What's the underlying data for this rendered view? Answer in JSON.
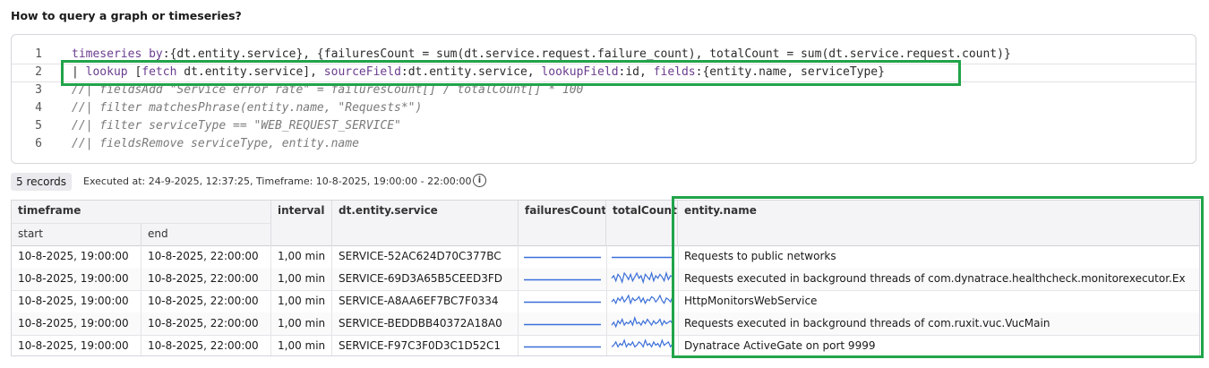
{
  "page": {
    "title": "How to query a graph or timeseries?"
  },
  "editor": {
    "lines": [
      {
        "num": "1",
        "parts": [
          {
            "t": "timeseries by",
            "c": "kw"
          },
          {
            "t": ":{dt.entity.service}, {failuresCount = sum(dt.service.request.failure_count), totalCount = sum(dt.service.request.count)}",
            "c": ""
          }
        ]
      },
      {
        "num": "2",
        "parts": [
          {
            "t": "| ",
            "c": ""
          },
          {
            "t": "lookup",
            "c": "kw"
          },
          {
            "t": " [",
            "c": ""
          },
          {
            "t": "fetch",
            "c": "kw"
          },
          {
            "t": " dt.entity.service], ",
            "c": ""
          },
          {
            "t": "sourceField",
            "c": "kw"
          },
          {
            "t": ":dt.entity.service, ",
            "c": ""
          },
          {
            "t": "lookupField",
            "c": "kw"
          },
          {
            "t": ":id, ",
            "c": ""
          },
          {
            "t": "fields",
            "c": "kw"
          },
          {
            "t": ":{entity.name, serviceType}",
            "c": ""
          }
        ]
      },
      {
        "num": "3",
        "parts": [
          {
            "t": "//| fieldsAdd \"Service error rate\" = failuresCount[] / totalCount[] * 100",
            "c": "comment"
          }
        ]
      },
      {
        "num": "4",
        "parts": [
          {
            "t": "//| filter matchesPhrase(entity.name, \"Requests*\")",
            "c": "comment"
          }
        ]
      },
      {
        "num": "5",
        "parts": [
          {
            "t": "//| filter serviceType == \"WEB_REQUEST_SERVICE\"",
            "c": "comment"
          }
        ]
      },
      {
        "num": "6",
        "parts": [
          {
            "t": "//| fieldsRemove serviceType, entity.name",
            "c": "comment"
          }
        ]
      }
    ]
  },
  "results": {
    "records_label": "5 records",
    "executed_text": "Executed at: 24-9-2025, 12:37:25, Timeframe: 10-8-2025, 19:00:00 - 22:00:00",
    "info_glyph": "i"
  },
  "table": {
    "group_header": "timeframe",
    "headers": {
      "start": "start",
      "end": "end",
      "interval": "interval",
      "service": "dt.entity.service",
      "failures": "failuresCount",
      "total": "totalCount",
      "entity_name": "entity.name"
    },
    "rows": [
      {
        "start": "10-8-2025, 19:00:00",
        "end": "10-8-2025, 22:00:00",
        "interval": "1,00 min",
        "service": "SERVICE-52AC624D70C377BC",
        "failures": [
          0,
          0,
          0,
          0,
          0,
          0,
          0,
          0,
          0,
          0,
          0,
          0,
          0,
          0,
          0,
          0,
          0,
          0,
          0,
          0,
          0,
          0,
          0,
          0,
          0,
          0,
          0,
          0,
          0,
          0
        ],
        "total": [
          0,
          0,
          0,
          0,
          0,
          0,
          0,
          0,
          0,
          0,
          0,
          0,
          0,
          0,
          0,
          0,
          0,
          0,
          0,
          0,
          0,
          0,
          0,
          0,
          0,
          0,
          0,
          0,
          0,
          0
        ],
        "entity_name": "Requests to public networks"
      },
      {
        "start": "10-8-2025, 19:00:00",
        "end": "10-8-2025, 22:00:00",
        "interval": "1,00 min",
        "service": "SERVICE-69D3A65B5CEED3FD",
        "failures": [
          0,
          0,
          0,
          0,
          0,
          0,
          0,
          0,
          0,
          0,
          0,
          0,
          0,
          0,
          0,
          0,
          0,
          0,
          0,
          0,
          0,
          0,
          0,
          0,
          0,
          0,
          0,
          0,
          0,
          0
        ],
        "total": [
          5,
          7,
          3,
          8,
          6,
          2,
          9,
          7,
          4,
          8,
          3,
          6,
          9,
          5,
          7,
          2,
          8,
          6,
          4,
          9,
          3,
          7,
          5,
          8,
          6,
          3,
          9,
          4,
          7,
          6
        ],
        "entity_name": "Requests executed in background threads of com.dynatrace.healthcheck.monitorexecutor.Ex"
      },
      {
        "start": "10-8-2025, 19:00:00",
        "end": "10-8-2025, 22:00:00",
        "interval": "1,00 min",
        "service": "SERVICE-A8AA6EF7BC7F0334",
        "failures": [
          0,
          0,
          0,
          0,
          0,
          0,
          0,
          0,
          0,
          0,
          0,
          0,
          0,
          0,
          0,
          0,
          0,
          0,
          0,
          0,
          0,
          0,
          0,
          0,
          0,
          0,
          0,
          0,
          0,
          0
        ],
        "total": [
          4,
          6,
          3,
          7,
          5,
          8,
          4,
          6,
          9,
          3,
          7,
          5,
          6,
          8,
          4,
          7,
          3,
          6,
          5,
          8,
          7,
          4,
          6,
          9,
          5,
          3,
          7,
          6,
          4,
          8
        ],
        "entity_name": "HttpMonitorsWebService"
      },
      {
        "start": "10-8-2025, 19:00:00",
        "end": "10-8-2025, 22:00:00",
        "interval": "1,00 min",
        "service": "SERVICE-BEDDBB40372A18A0",
        "failures": [
          0,
          0,
          0,
          0,
          0,
          0,
          0,
          0,
          0,
          0,
          0,
          0,
          0,
          0,
          0,
          0,
          0,
          0,
          0,
          0,
          0,
          0,
          0,
          0,
          0,
          0,
          0,
          0,
          0,
          0
        ],
        "total": [
          3,
          5,
          2,
          6,
          4,
          7,
          3,
          5,
          4,
          6,
          3,
          8,
          4,
          5,
          3,
          6,
          4,
          7,
          5,
          3,
          6,
          4,
          5,
          7,
          3,
          6,
          4,
          5,
          6,
          4
        ],
        "entity_name": "Requests executed in background threads of com.ruxit.vuc.VucMain"
      },
      {
        "start": "10-8-2025, 19:00:00",
        "end": "10-8-2025, 22:00:00",
        "interval": "1,00 min",
        "service": "SERVICE-F97C3F0D3C1D52C1",
        "failures": [
          0,
          0,
          0,
          0,
          0,
          0,
          0,
          0,
          0,
          0,
          0,
          0,
          0,
          0,
          0,
          0,
          0,
          0,
          0,
          0,
          0,
          0,
          0,
          0,
          0,
          0,
          0,
          0,
          0,
          0
        ],
        "total": [
          3,
          4,
          6,
          3,
          5,
          4,
          7,
          3,
          5,
          4,
          6,
          3,
          4,
          6,
          5,
          3,
          7,
          4,
          5,
          3,
          6,
          4,
          5,
          3,
          7,
          4,
          5,
          6,
          3,
          5
        ],
        "entity_name": "Dynatrace ActiveGate on port 9999"
      }
    ]
  },
  "colors": {
    "accent": "#3b6fd8",
    "highlight": "#21a44a",
    "keyword": "#6a3d8f"
  }
}
